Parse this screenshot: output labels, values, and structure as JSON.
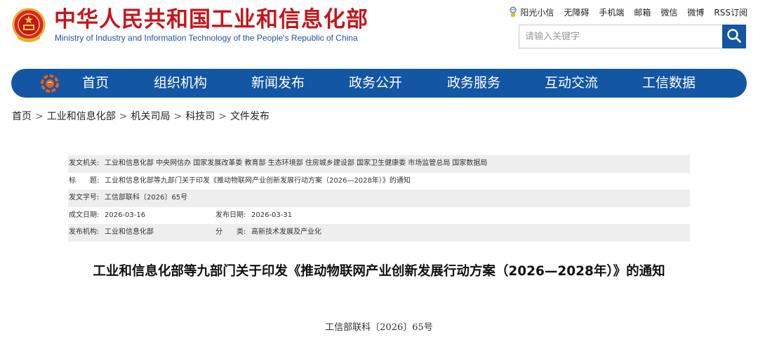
{
  "header": {
    "title_cn": "中华人民共和国工业和信息化部",
    "title_en": "Ministry of Industry and Information Technology of the People's Republic of China"
  },
  "top_links": [
    "阳光小信",
    "无障碍",
    "手机端",
    "邮箱",
    "微信",
    "微博",
    "RSS订阅"
  ],
  "search": {
    "placeholder": "请输入关键字"
  },
  "nav": {
    "items": [
      "首页",
      "组织机构",
      "新闻发布",
      "政务公开",
      "政务服务",
      "互动交流",
      "工信数据"
    ]
  },
  "breadcrumb": [
    "首页",
    "工业和信息化部",
    "机关司局",
    "科技司",
    "文件发布"
  ],
  "breadcrumb_separator": ">",
  "info": {
    "issuer_label": "发文机关:",
    "issuer": "工业和信息化部 中央网信办 国家发展改革委 教育部 生态环境部 住房城乡建设部 国家卫生健康委 市场监管总局 国家数据局",
    "title_label": "标　　题:",
    "title": "工业和信息化部等九部门关于印发《推动物联网产业创新发展行动方案（2026—2028年）》的通知",
    "doc_no_label": "发文字号:",
    "doc_no": "工信部联科〔2026〕65号",
    "created_label": "成文日期:",
    "created": "2026-03-16",
    "published_label": "发布日期:",
    "published": "2026-03-31",
    "publisher_label": "发布机构:",
    "publisher": "工业和信息化部",
    "category_label": "分　　类:",
    "category": "高新技术发展及产业化"
  },
  "article": {
    "title": "工业和信息化部等九部门关于印发《推动物联网产业创新发展行动方案（2026—2028年）》的通知",
    "doc_number": "工信部联科〔2026〕65号"
  },
  "colors": {
    "brand_red": "#c4161c",
    "brand_blue": "#1356a4",
    "row_shade": "#eeeeee"
  }
}
